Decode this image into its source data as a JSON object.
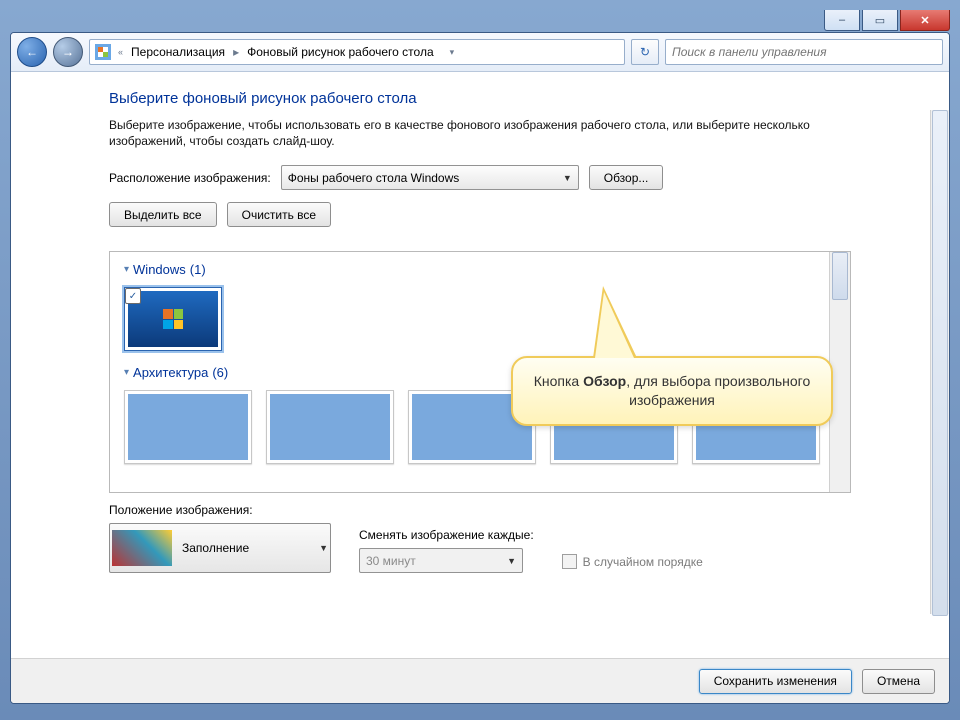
{
  "titlebar": {
    "min_label": "–",
    "max_label": "▭",
    "close_label": "✕"
  },
  "nav": {
    "back_label": "←",
    "fwd_label": "→",
    "dc": "«",
    "bc_items": [
      "Персонализация",
      "Фоновый рисунок рабочего стола"
    ],
    "bc_sep": "▸",
    "refresh_label": "↻",
    "search_placeholder": "Поиск в панели управления"
  },
  "main": {
    "title": "Выберите фоновый рисунок рабочего стола",
    "desc": "Выберите изображение, чтобы использовать его в качестве фонового изображения рабочего стола, или выберите несколько изображений, чтобы создать слайд-шоу.",
    "location_label": "Расположение изображения:",
    "location_value": "Фоны рабочего стола Windows",
    "browse_label": "Обзор...",
    "select_all": "Выделить все",
    "clear_all": "Очистить все",
    "groups": {
      "windows": {
        "label": "Windows",
        "count": "(1)"
      },
      "arch": {
        "label": "Архитектура",
        "count": "(6)"
      }
    },
    "position_label": "Положение изображения:",
    "position_value": "Заполнение",
    "interval_label": "Сменять изображение каждые:",
    "interval_value": "30 минут",
    "shuffle": "В случайном порядке"
  },
  "callout": {
    "prefix": "Кнопка ",
    "bold": "Обзор",
    "suffix": ", для выбора произвольного изображения"
  },
  "footer": {
    "save": "Сохранить изменения",
    "cancel": "Отмена"
  }
}
